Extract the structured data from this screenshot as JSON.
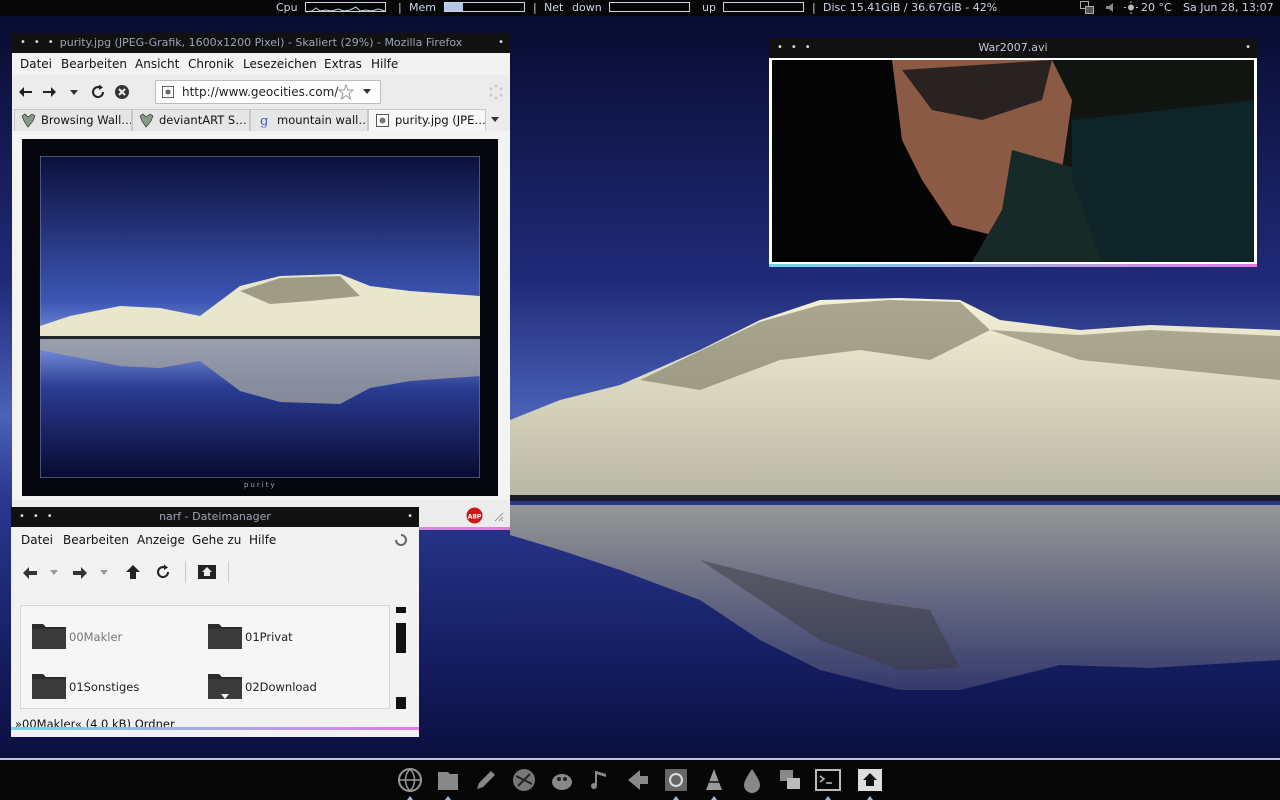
{
  "top_panel": {
    "cpu_label": "Cpu",
    "mem_label": "Mem",
    "mem_fraction": 0.23,
    "net_label": "Net",
    "down_label": "down",
    "up_label": "up",
    "separator": "|",
    "disc_text": "Disc 15.41GiB  / 36.67GiB - 42%",
    "temperature": "20 °C",
    "datetime": "Sa Jun 28, 13:07"
  },
  "firefox": {
    "title": "purity.jpg (JPEG-Grafik, 1600x1200 Pixel) - Skaliert (29%) - Mozilla Firefox",
    "menu": [
      "Datei",
      "Bearbeiten",
      "Ansicht",
      "Chronik",
      "Lesezeichen",
      "Extras",
      "Hilfe"
    ],
    "url": "http://www.geocities.com/",
    "tabs": [
      {
        "label": "Browsing Wall…",
        "icon": "deviantart-icon"
      },
      {
        "label": "deviantART S…",
        "icon": "deviantart-icon"
      },
      {
        "label": "mountain wall…",
        "icon": "google-icon"
      },
      {
        "label": "purity.jpg (JPE…",
        "icon": "image-icon"
      }
    ],
    "image_caption": "purity",
    "adblock_label": "ABP"
  },
  "video": {
    "title": "War2007.avi"
  },
  "filemanager": {
    "title": "narf - Dateimanager",
    "menu": [
      "Datei",
      "Bearbeiten",
      "Anzeige",
      "Gehe zu",
      "Hilfe"
    ],
    "folders": [
      "00Makler",
      "01Privat",
      "01Sonstiges",
      "02Download"
    ],
    "status": "»00Makler« (4,0 kB) Ordner"
  },
  "dock": {
    "icons": [
      "globe-icon",
      "files-icon",
      "pencil-icon",
      "network-icon",
      "gimp-icon",
      "music-note-icon",
      "arrow-icon",
      "photo-icon",
      "vlc-icon",
      "drop-icon",
      "windows-icon",
      "terminal-icon",
      "home-icon"
    ]
  },
  "colors": {
    "accent_start": "#6fd6e8",
    "accent_end": "#e27be0",
    "panel_bg": "#070707"
  }
}
